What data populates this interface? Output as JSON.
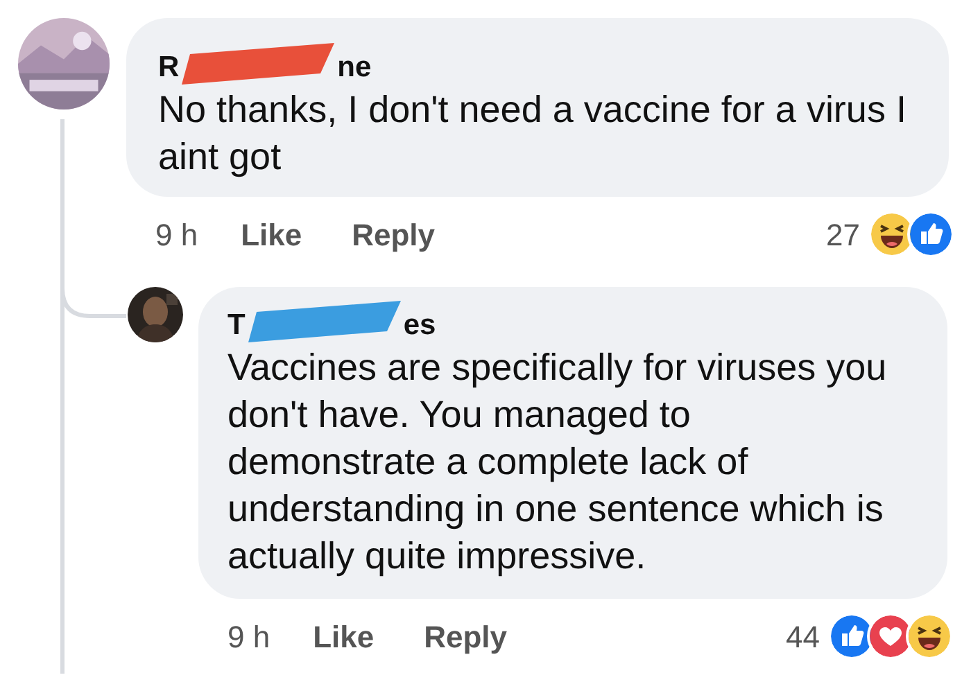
{
  "comments": [
    {
      "author_start": "R",
      "author_end": "ne",
      "redaction": {
        "color": "#e8503a"
      },
      "text": "No thanks, I don't need a vaccine for a virus I aint got",
      "time": "9 h",
      "like": "Like",
      "reply": "Reply",
      "reaction_count": "27",
      "reactions": [
        {
          "kind": "haha"
        },
        {
          "kind": "like"
        }
      ],
      "avatar": {
        "kind": "picture"
      }
    },
    {
      "author_start": "T",
      "author_end": "es",
      "redaction": {
        "color": "#3b9de0"
      },
      "text": "Vaccines are specifically for viruses you don't have. You managed to demonstrate a complete lack of understanding in one sentence which is actually quite impressive.",
      "time": "9 h",
      "like": "Like",
      "reply": "Reply",
      "reaction_count": "44",
      "reactions": [
        {
          "kind": "like"
        },
        {
          "kind": "love"
        },
        {
          "kind": "haha"
        }
      ],
      "avatar": {
        "kind": "picture"
      }
    }
  ]
}
